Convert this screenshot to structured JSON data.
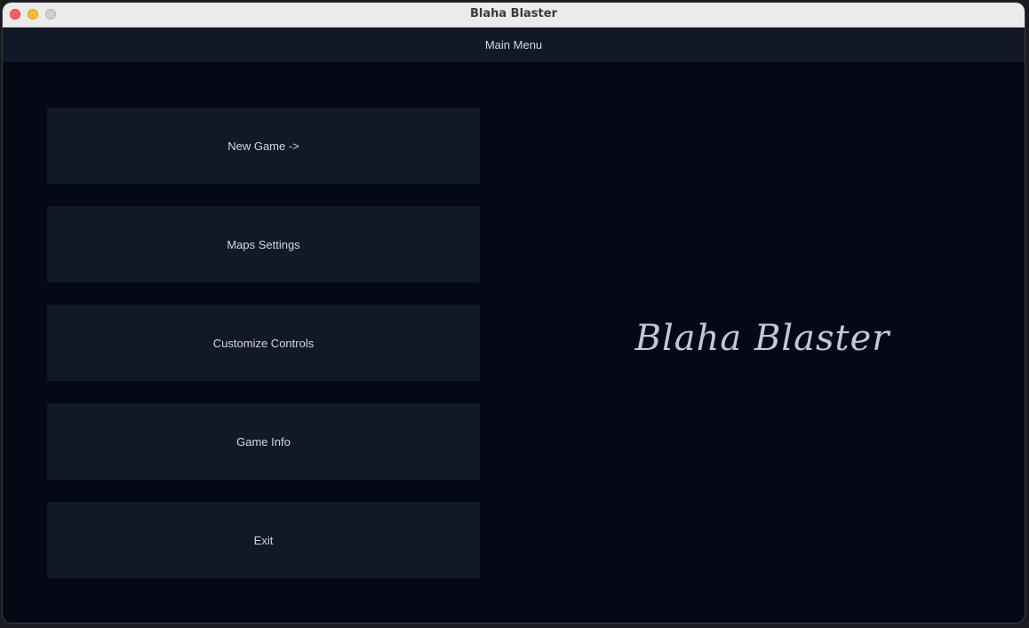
{
  "window": {
    "title": "Blaha Blaster"
  },
  "header": {
    "title": "Main Menu"
  },
  "menu": {
    "new_game": "New Game ->",
    "maps_settings": "Maps Settings",
    "customize_controls": "Customize Controls",
    "game_info": "Game Info",
    "exit": "Exit"
  },
  "logo": {
    "text": "Blaha Blaster"
  },
  "colors": {
    "background": "#050916",
    "panel": "#111827",
    "text": "#d3d7df"
  }
}
